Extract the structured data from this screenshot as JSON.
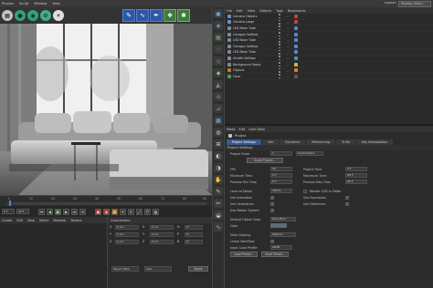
{
  "menubar": {
    "items": [
      "Plugins",
      "Script",
      "Window",
      "Help"
    ],
    "layout_label": "Layout:",
    "layout_value": "Startup (User)"
  },
  "toolbar": {
    "round_icons": [
      {
        "name": "render-icon",
        "color": "#c5c5c5"
      },
      {
        "name": "render-settings-icon",
        "color": "#2fa37a"
      },
      {
        "name": "ipr-icon",
        "color": "#2fa37a"
      },
      {
        "name": "material-icon",
        "color": "#3eb083"
      },
      {
        "name": "light-icon",
        "color": "#e0e0e0"
      }
    ],
    "square_icons": [
      "brush-icon",
      "deformer-icon",
      "spline-pen-icon",
      "generator-icon",
      "scene-icon"
    ],
    "square_glyphs": [
      "✎",
      "∿",
      "✒",
      "❖",
      "✱"
    ]
  },
  "timeline": {
    "ticks": [
      "0",
      "10",
      "20",
      "30",
      "40",
      "50",
      "60",
      "70",
      "80",
      "90"
    ]
  },
  "transport": {
    "start_field": "0 F",
    "end_field": "90 F"
  },
  "material": {
    "menu": [
      "Create",
      "Edit",
      "View",
      "Select",
      "Material",
      "Texture"
    ]
  },
  "coordinates": {
    "title": "Coordinates",
    "rows": [
      {
        "axis": "X",
        "pos": "0 cm",
        "size_label": "X",
        "size": "0 cm",
        "rot_label": "H",
        "rot": "0°"
      },
      {
        "axis": "Y",
        "pos": "0 cm",
        "size_label": "Y",
        "size": "0 cm",
        "rot_label": "P",
        "rot": "0°"
      },
      {
        "axis": "Z",
        "pos": "0 cm",
        "size_label": "Z",
        "size": "0 cm",
        "rot_label": "B",
        "rot": "0°"
      }
    ],
    "mode_select": "Object (Rel)",
    "size_select": "Size",
    "apply_label": "Apply"
  },
  "object_manager": {
    "menu": [
      "File",
      "Edit",
      "View",
      "Objects",
      "Tags",
      "Bookmarks"
    ],
    "objects": [
      {
        "name": "Camera Objects",
        "color": "#6a8fc9",
        "tag": "#cf3b3b"
      },
      {
        "name": "Camera Large",
        "color": "#6a8fc9",
        "tag": "#cf3b3b"
      },
      {
        "name": "LED Neon Tube",
        "color": "#7d8c9a",
        "tag": "#4f88d8"
      },
      {
        "name": "Octagon Softbox",
        "color": "#7d8c9a",
        "tag": "#4f88d8"
      },
      {
        "name": "LED Neon Tube",
        "color": "#7d8c9a",
        "tag": "#4f88d8"
      },
      {
        "name": "Octagon Softbox",
        "color": "#7d8c9a",
        "tag": "#4f88d8"
      },
      {
        "name": "LED Neon Tube",
        "color": "#7d8c9a",
        "tag": "#4f88d8"
      },
      {
        "name": "Giraffe Softbox",
        "color": "#7d8c9a",
        "tag": "#4f88d8"
      },
      {
        "name": "Background Stand",
        "color": "#7d8c9a",
        "tag": "#d6b24a"
      },
      {
        "name": "Objects",
        "color": "#c97a22",
        "tag": "#e07a2f"
      },
      {
        "name": "Floor",
        "color": "#4a9d5a",
        "tag": "#5a5a5a"
      }
    ]
  },
  "attributes": {
    "menu": [
      "Mode",
      "Edit",
      "User Data"
    ],
    "object_label": "Project",
    "tabs": [
      "Project Settings",
      "Info",
      "Dynamics",
      "Referencing",
      "To Do",
      "Key Interpolation"
    ],
    "section": "Project Settings",
    "project_scale_label": "Project Scale",
    "project_scale_value": "1",
    "project_scale_unit": "Centimeters",
    "scale_project_button": "Scale Project...",
    "fps_label": "FPS",
    "fps_value": "30",
    "project_time_label": "Project Time",
    "project_time_value": "0 F",
    "min_time_label": "Minimum Time",
    "min_time_value": "0 F",
    "max_time_label": "Maximum Time",
    "max_time_value": "90 F",
    "preview_min_label": "Preview Min Time",
    "preview_min_value": "0 F",
    "preview_max_label": "Preview Max Time",
    "preview_max_value": "90 F",
    "lod_label": "Level of Detail",
    "lod_value": "100 %",
    "render_lod_label": "Render LOD in Editor",
    "use_animation_label": "Use Animation",
    "use_expression_label": "Use Expression",
    "use_generators_label": "Use Generators",
    "use_deformers_label": "Use Deformers",
    "use_motion_label": "Use Motion System",
    "default_color_label": "Default Object Color",
    "default_color_value": "Gray-Blue",
    "color_label": "Color",
    "view_clipping_label": "View Clipping",
    "view_clipping_value": "Medium",
    "linear_workflow_label": "Linear Workflow",
    "input_color_label": "Input Color Profile",
    "input_color_value": "sRGB",
    "load_preset_button": "Load Preset...",
    "save_preset_button": "Save Preset..."
  }
}
